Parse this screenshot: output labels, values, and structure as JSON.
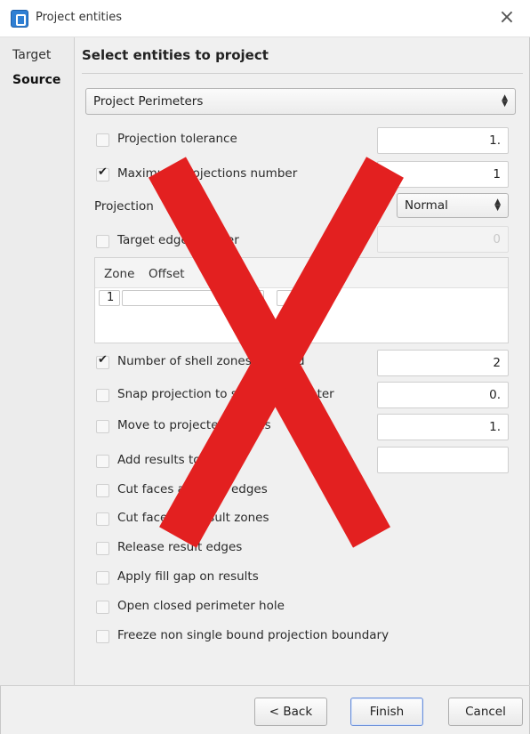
{
  "window": {
    "title": "Project entities",
    "close_glyph": "×"
  },
  "sidebar": {
    "items": [
      {
        "label": "Target"
      },
      {
        "label": "Source"
      }
    ]
  },
  "main": {
    "heading": "Select entities to project",
    "mode_select": {
      "value": "Project Perimeters"
    },
    "options": {
      "projection_tolerance": {
        "label": "Projection tolerance",
        "checked": false,
        "value": "1."
      },
      "max_projections": {
        "label": "Maximum projections number",
        "checked": true,
        "value": "1"
      },
      "projection_method": {
        "label": "Projection",
        "value": "Normal"
      },
      "target_edge": {
        "label": "Target edge number",
        "checked": false,
        "value": "0"
      },
      "shell_zones": {
        "label": "Number of shell zones affected",
        "checked": true,
        "value": "2"
      },
      "snap_projection": {
        "label": "Snap projection to source perimeter",
        "checked": false,
        "value": "0."
      },
      "move_to_projected": {
        "label": "Move to projected perims",
        "checked": false,
        "value": "1."
      },
      "add_result_set": {
        "label": "Add results to set",
        "checked": false,
        "value": ""
      }
    },
    "zone_table": {
      "columns": [
        "Zone",
        "Offset"
      ],
      "rows": [
        {
          "zone": "1",
          "offset": ""
        }
      ]
    },
    "flags": [
      {
        "label": "Cut faces at result edges",
        "checked": false
      },
      {
        "label": "Cut faces on result zones",
        "checked": false
      },
      {
        "label": "Release result edges",
        "checked": false
      },
      {
        "label": "Apply fill gap on results",
        "checked": false
      },
      {
        "label": "Open closed perimeter hole",
        "checked": false
      },
      {
        "label": "Freeze non single bound projection boundary",
        "checked": false
      }
    ]
  },
  "footer": {
    "back": "< Back",
    "finish": "Finish",
    "cancel": "Cancel"
  },
  "overlay": {
    "icon": "red-x-cross",
    "color": "#e32020"
  }
}
